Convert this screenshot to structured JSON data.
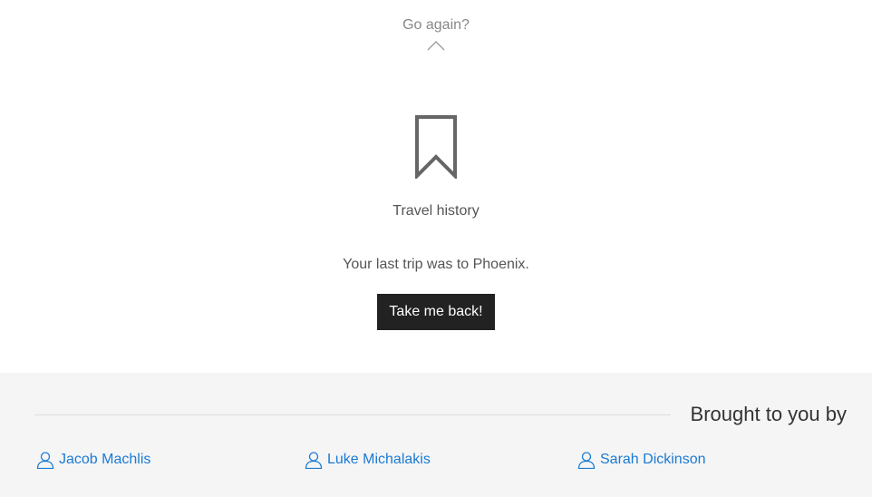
{
  "go_again": {
    "label": "Go again?",
    "icon": "chevron-up-icon"
  },
  "history": {
    "icon": "bookmark-icon",
    "title": "Travel history",
    "message": "Your last trip was to Phoenix.",
    "button_label": "Take me back!"
  },
  "footer": {
    "heading": "Brought to you by",
    "credits": [
      {
        "name": "Jacob Machlis",
        "icon": "user-icon"
      },
      {
        "name": "Luke Michalakis",
        "icon": "user-icon"
      },
      {
        "name": "Sarah Dickinson",
        "icon": "user-icon"
      }
    ]
  },
  "colors": {
    "link": "#1a7ad4",
    "button_bg": "#222222",
    "footer_bg": "#f5f5f5",
    "muted_text": "#888888"
  }
}
